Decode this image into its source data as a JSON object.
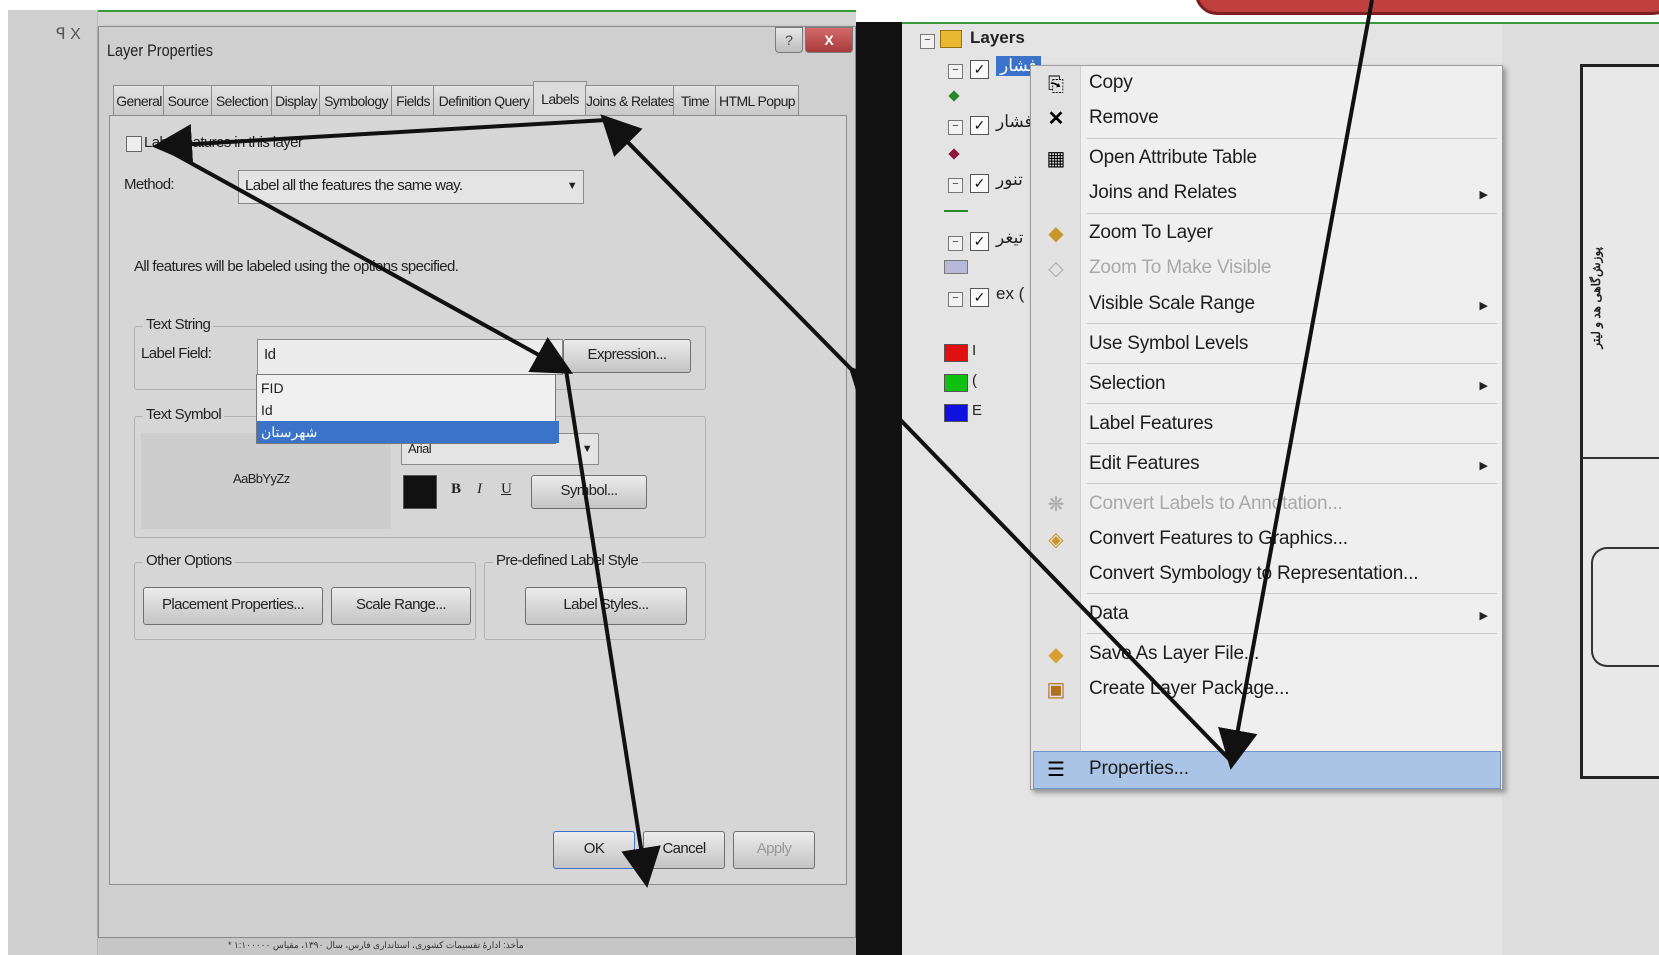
{
  "left": {
    "dialog": {
      "title": "Layer Properties",
      "help_label": "?",
      "close_label": "X",
      "tabs": [
        "General",
        "Source",
        "Selection",
        "Display",
        "Symbology",
        "Fields",
        "Definition Query",
        "Labels",
        "Joins & Relates",
        "Time",
        "HTML Popup"
      ],
      "active_tab": "Labels",
      "label_features_checkbox": "Label features in this layer",
      "method_label": "Method:",
      "method_value": "Label all the features the same way.",
      "info_text": "All features will be labeled using the options specified.",
      "text_string_group": "Text String",
      "label_field_label": "Label Field:",
      "label_field_value": "Id",
      "expression_button": "Expression...",
      "dropdown_options": [
        "FID",
        "Id",
        "شهرستان"
      ],
      "selected_option": "شهرستان",
      "text_symbol_group": "Text Symbol",
      "symbol_preview": "AaBbYyZz",
      "font_value": "Arial",
      "bold_label": "B",
      "italic_label": "I",
      "underline_label": "U",
      "symbol_button": "Symbol...",
      "other_options_group": "Other Options",
      "placement_button": "Placement Properties...",
      "scale_range_button": "Scale Range...",
      "predefined_group": "Pre-defined Label Style",
      "label_styles_button": "Label Styles...",
      "ok_button": "OK",
      "cancel_button": "Cancel",
      "apply_button": "Apply"
    },
    "panel_pin": "ꟼ X",
    "footer_text": "* مأخذ: ادارهٔ تقسیمات کشوری، استانداری فارس، سال ۱۳۹۰، مقیاس ۱:۱۰۰۰۰۰"
  },
  "right": {
    "toc_root": "Layers",
    "layers": [
      {
        "name": "فشار",
        "checked": true,
        "symbol_color": "#2a8a2a"
      },
      {
        "name": "فشار",
        "checked": true,
        "symbol_color": "#8a1a3a"
      },
      {
        "name": "تنور",
        "checked": true,
        "symbol_color": "#2a8a2a"
      },
      {
        "name": "تیغر",
        "checked": true,
        "symbol_color": "#b8b8d8"
      },
      {
        "name": "ex (",
        "checked": true,
        "symbol_color": null
      }
    ],
    "legend_swatches": [
      {
        "color": "#e01010",
        "label": "I"
      },
      {
        "color": "#10c010",
        "label": "("
      },
      {
        "color": "#1010e0",
        "label": "E"
      }
    ],
    "context_menu": [
      {
        "label": "Copy",
        "icon": "copy-icon",
        "enabled": true,
        "submenu": false
      },
      {
        "label": "Remove",
        "icon": "remove-icon",
        "enabled": true,
        "submenu": false
      },
      {
        "label": "Open Attribute Table",
        "icon": "table-icon",
        "enabled": true,
        "submenu": false
      },
      {
        "label": "Joins and Relates",
        "icon": "",
        "enabled": true,
        "submenu": true
      },
      {
        "label": "Zoom To Layer",
        "icon": "zoom-layer-icon",
        "enabled": true,
        "submenu": false
      },
      {
        "label": "Zoom To Make Visible",
        "icon": "zoom-visible-icon",
        "enabled": false,
        "submenu": false
      },
      {
        "label": "Visible Scale Range",
        "icon": "",
        "enabled": true,
        "submenu": true
      },
      {
        "label": "Use Symbol Levels",
        "icon": "",
        "enabled": true,
        "submenu": false
      },
      {
        "label": "Selection",
        "icon": "",
        "enabled": true,
        "submenu": true
      },
      {
        "label": "Label Features",
        "icon": "",
        "enabled": true,
        "submenu": false
      },
      {
        "label": "Edit Features",
        "icon": "",
        "enabled": true,
        "submenu": true
      },
      {
        "label": "Convert Labels to Annotation...",
        "icon": "convert-labels-icon",
        "enabled": false,
        "submenu": false
      },
      {
        "label": "Convert Features to Graphics...",
        "icon": "convert-graphics-icon",
        "enabled": true,
        "submenu": false
      },
      {
        "label": "Convert Symbology to Representation...",
        "icon": "",
        "enabled": true,
        "submenu": false
      },
      {
        "label": "Data",
        "icon": "",
        "enabled": true,
        "submenu": true
      },
      {
        "label": "Save As Layer File...",
        "icon": "layer-file-icon",
        "enabled": true,
        "submenu": false
      },
      {
        "label": "Create Layer Package...",
        "icon": "layer-package-icon",
        "enabled": true,
        "submenu": false
      },
      {
        "label": "Properties...",
        "icon": "properties-icon",
        "enabled": true,
        "submenu": false,
        "highlighted": true
      }
    ],
    "map_title_vertical": "پوزش‌گاهی هد و لیتر"
  },
  "colors": {
    "panel_border": "#3a9a3a",
    "callout": "#c04040",
    "menu_highlight": "#aac4e6",
    "dropdown_selected": "#3a73c8",
    "arrow": "#111111"
  }
}
